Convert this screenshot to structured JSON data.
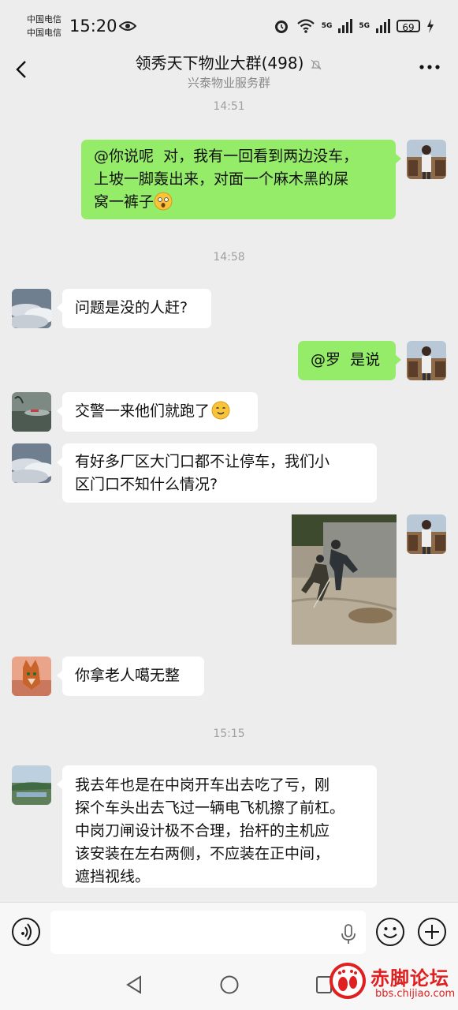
{
  "status_bar": {
    "carrier1": "中国电信",
    "carrier2": "中国电信",
    "time": "15:20",
    "net1": "5G",
    "net2": "5G",
    "battery": "69"
  },
  "header": {
    "title": "领秀天下物业大群(498)",
    "subtitle": "兴泰物业服务群"
  },
  "messages": {
    "ts1": "14:51",
    "m1": "@你说呢  对，我有一回看到两边没车，\n上坡一脚轰出来，对面一个麻木黑的屎\n窝一裤子",
    "ts2": "14:58",
    "m2": "问题是没的人赶?",
    "m3": "@罗  是说",
    "m4": "交警一来他们就跑了",
    "m5": "有好多厂区大门口都不让停车，我们小\n区门口不知什么情况?",
    "m7": "你拿老人噶无整",
    "ts3": "15:15",
    "m8": "我去年也是在中岗开车出去吃了亏，刚\n探个车头出去飞过一辆电飞机擦了前杠。\n中岗刀闸设计极不合理，抬杆的主机应\n该安装在左右两侧，不应装在正中间，\n遮挡视线。"
  },
  "watermark": {
    "text": "赤脚论坛",
    "url": "bbs.chijiao.com"
  },
  "colors": {
    "background": "#ededed",
    "bubble_self": "#95ec69",
    "bubble_other": "#ffffff",
    "watermark": "#e02020"
  },
  "icons": [
    "back-arrow-icon",
    "mute-bell-icon",
    "more-icon",
    "voice-icon",
    "microphone-icon",
    "emoji-icon",
    "plus-icon",
    "nav-back-icon",
    "nav-home-icon",
    "nav-recent-icon"
  ]
}
